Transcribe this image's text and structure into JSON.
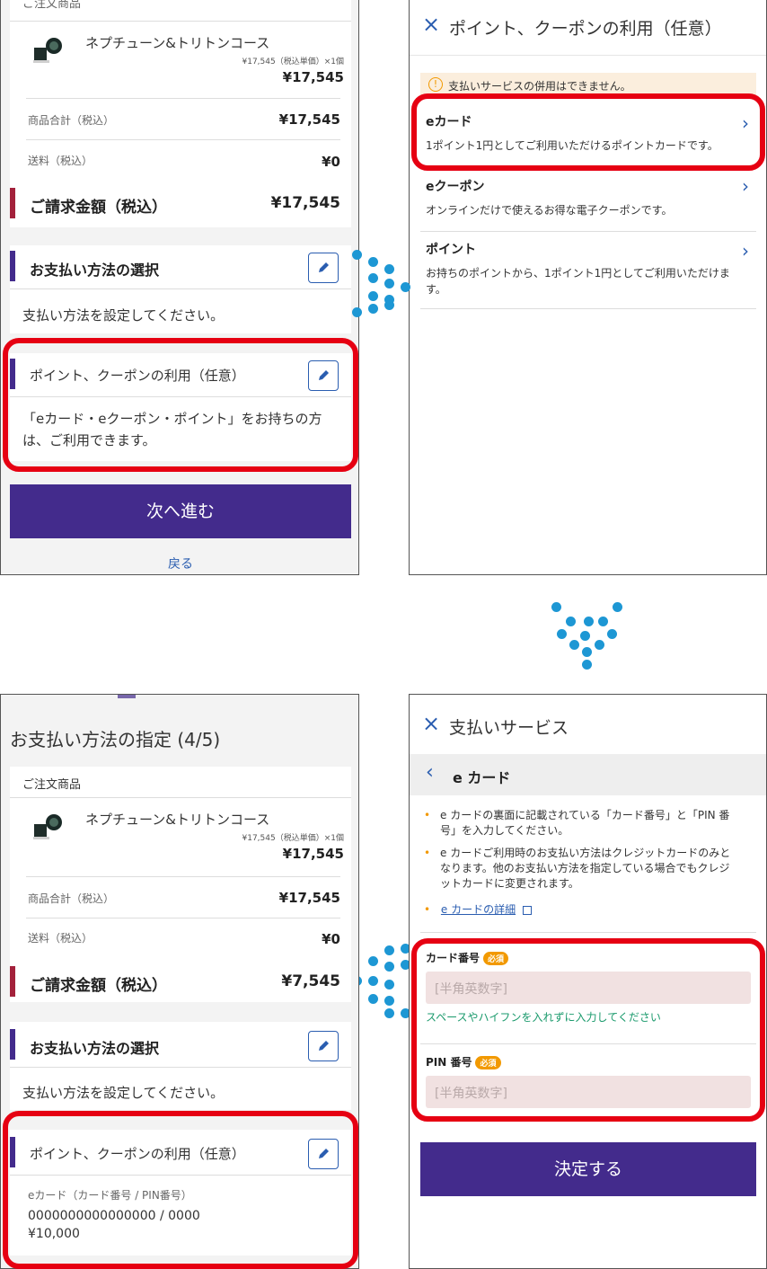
{
  "cart": {
    "section_label": "ご注文商品",
    "product_name": "ネプチューン&トリトンコース",
    "unit_price_line": "¥17,545（税込単価）×1個",
    "product_price": "¥17,545",
    "subtotal_label": "商品合計（税込）",
    "subtotal_value": "¥17,545",
    "shipping_label": "送料（税込）",
    "shipping_value": "¥0",
    "total_label": "ご請求金額（税込）",
    "total_value": "¥17,545",
    "total_value_after": "¥7,545"
  },
  "payment": {
    "title": "お支払い方法の選択",
    "body": "支払い方法を設定してください。"
  },
  "points": {
    "title": "ポイント、クーポンの利用（任意）",
    "body_line1": "「eカード・eクーポン・ポイント」をお持ちの方",
    "body_line2": "は、ご利用できます。",
    "applied_label": "eカード（カード番号 / PIN番号）",
    "applied_numbers": "0000000000000000 / 0000",
    "applied_amount": "¥10,000"
  },
  "buttons": {
    "next": "次へ進む",
    "back": "戻る",
    "confirm": "決定する"
  },
  "page": {
    "title": "お支払い方法の指定 (4/5)"
  },
  "modal": {
    "close_icon": "×",
    "title": "ポイント、クーポンの利用（任意）",
    "notice": "支払いサービスの併用はできません。",
    "items": [
      {
        "title": "eカード",
        "desc": "1ポイント1円としてご利用いただけるポイントカードです。"
      },
      {
        "title": "eクーポン",
        "desc": "オンラインだけで使えるお得な電子クーポンです。"
      },
      {
        "title": "ポイント",
        "desc1": "お持ちのポイントから、1ポイント1円としてご利用いただけま",
        "desc2": "す。"
      }
    ]
  },
  "ecard_form": {
    "title": "支払いサービス",
    "back_label": "e カード",
    "bullets": [
      {
        "line1": "e カードの裏面に記載されている「カード番号」と「PIN 番",
        "line2": "号」を入力してください。"
      },
      {
        "line1": "e カードご利用時のお支払い方法はクレジットカードのみと",
        "line2": "なります。他のお支払い方法を指定している場合でもクレジ",
        "line3": "ットカードに変更されます。"
      }
    ],
    "detail_link": "e カードの詳細",
    "card_label": "カード番号",
    "pin_label": "PIN 番号",
    "required": "必須",
    "placeholder": "[半角英数字]",
    "hint": "スペースやハイフンを入れずに入力してください"
  },
  "colors": {
    "accent_purple": "#432b8c",
    "accent_red_bar": "#a3213b",
    "highlight_red": "#e60012",
    "link_blue": "#2a5db0",
    "arrow_dot_blue": "#1d97d4",
    "hint_green": "#1a9a6c",
    "required_orange": "#f29900"
  }
}
